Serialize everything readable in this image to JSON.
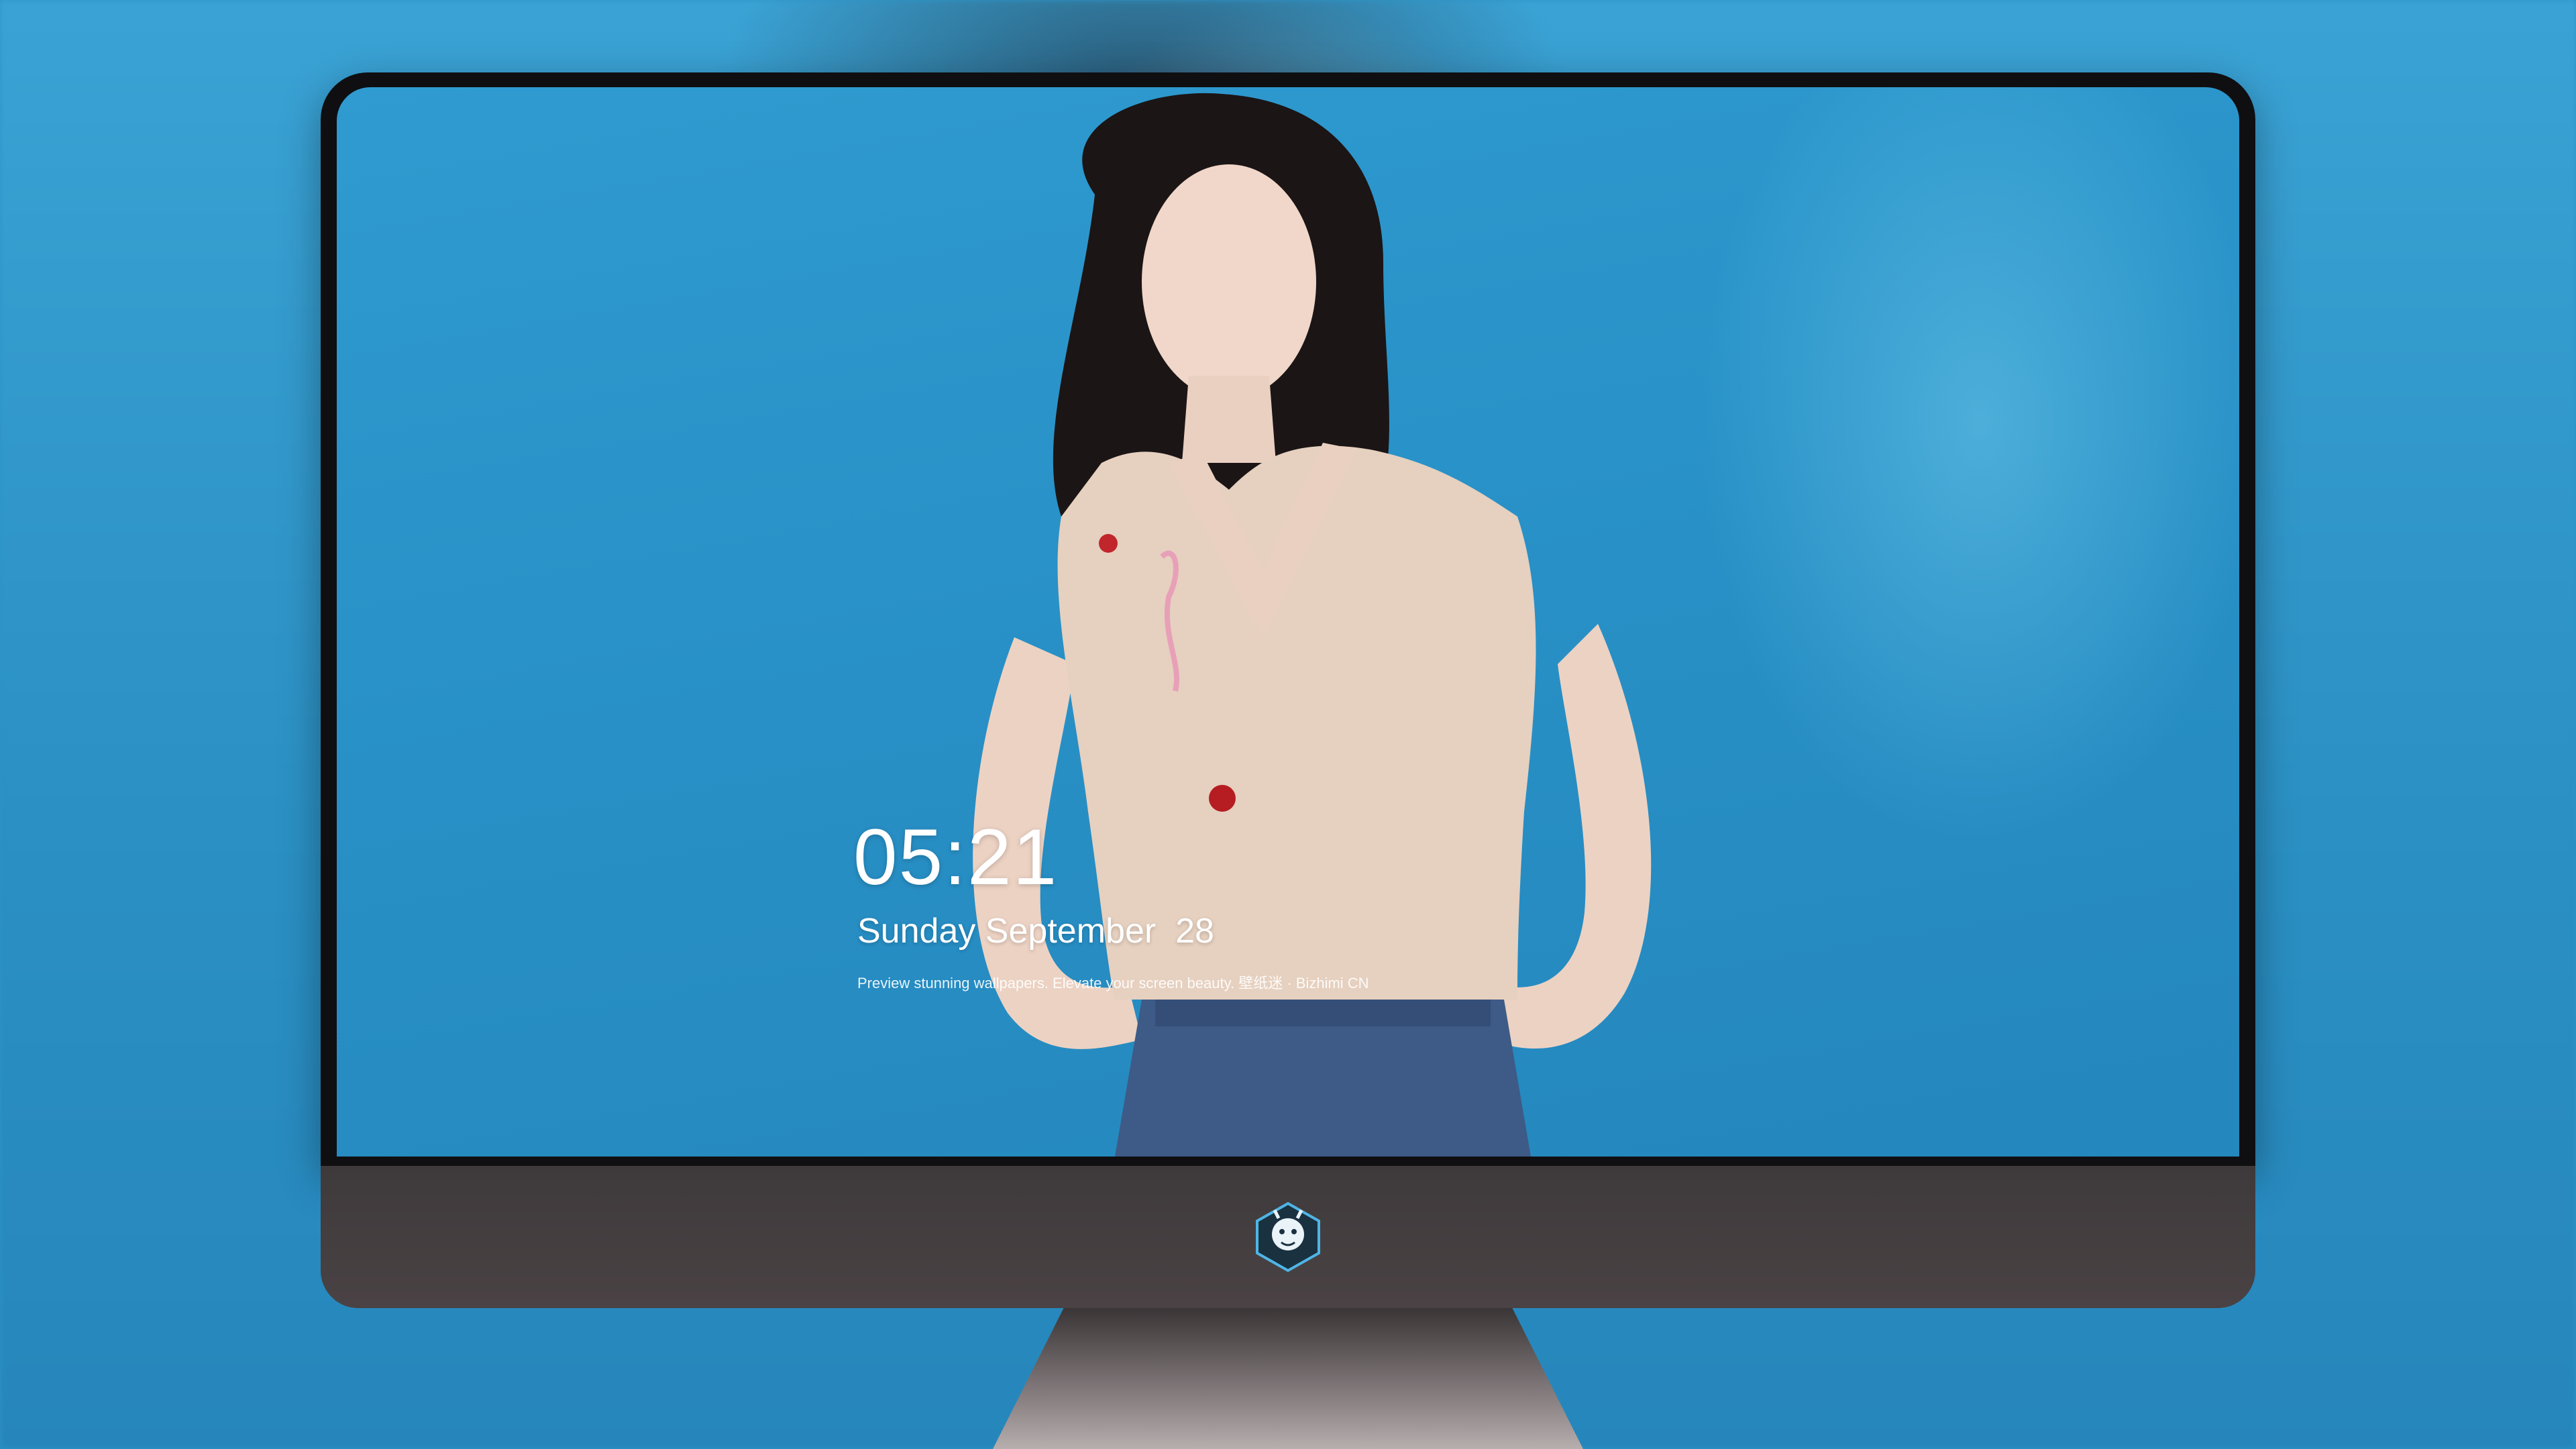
{
  "lockscreen": {
    "time": "05:21",
    "date": "Sunday September  28",
    "caption": "Preview stunning wallpapers. Elevate your screen beauty. 壁纸迷 · Bizhimi CN"
  },
  "dock": {
    "apps": [
      {
        "name": "messages-icon",
        "color": "#34c759"
      },
      {
        "name": "weather-icon",
        "color": "#1e90ff"
      },
      {
        "name": "clock-icon",
        "color": "#ffffff"
      },
      {
        "name": "preview-icon",
        "color": "#f2c94c"
      },
      {
        "name": "clips-icon",
        "color": "#5ac8fa"
      },
      {
        "name": "notes-icon",
        "color": "#ffd60a"
      },
      {
        "name": "photo-booth-icon",
        "color": "#e5e5e5"
      },
      {
        "name": "itunes-icon",
        "color": "#d946ef"
      },
      {
        "name": "app-store-icon",
        "color": "#1a8cff"
      },
      {
        "name": "camera-icon",
        "color": "#6e6e73"
      }
    ]
  },
  "colors": {
    "wallpaper": "#2992c8",
    "bezel": "#0f0f12",
    "chin": "#433d3f"
  }
}
